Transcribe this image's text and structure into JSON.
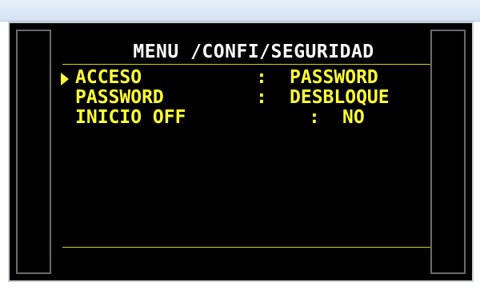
{
  "screen": {
    "title": "MENU /CONFI/SEGURIDAD",
    "items": [
      {
        "label": "ACCESO",
        "separator": ":",
        "value": "PASSWORD",
        "selected": true
      },
      {
        "label": "PASSWORD",
        "separator": ":",
        "value": "DESBLOQUE",
        "selected": false
      },
      {
        "label": "INICIO OFF",
        "separator": ":",
        "value": "NO",
        "selected": false
      }
    ]
  },
  "colors": {
    "menu_text": "#ffff33",
    "title_text": "#ffffff",
    "background": "#000000",
    "rule": "#d4d400"
  },
  "icons": {
    "cursor": "selection-arrow-icon"
  }
}
